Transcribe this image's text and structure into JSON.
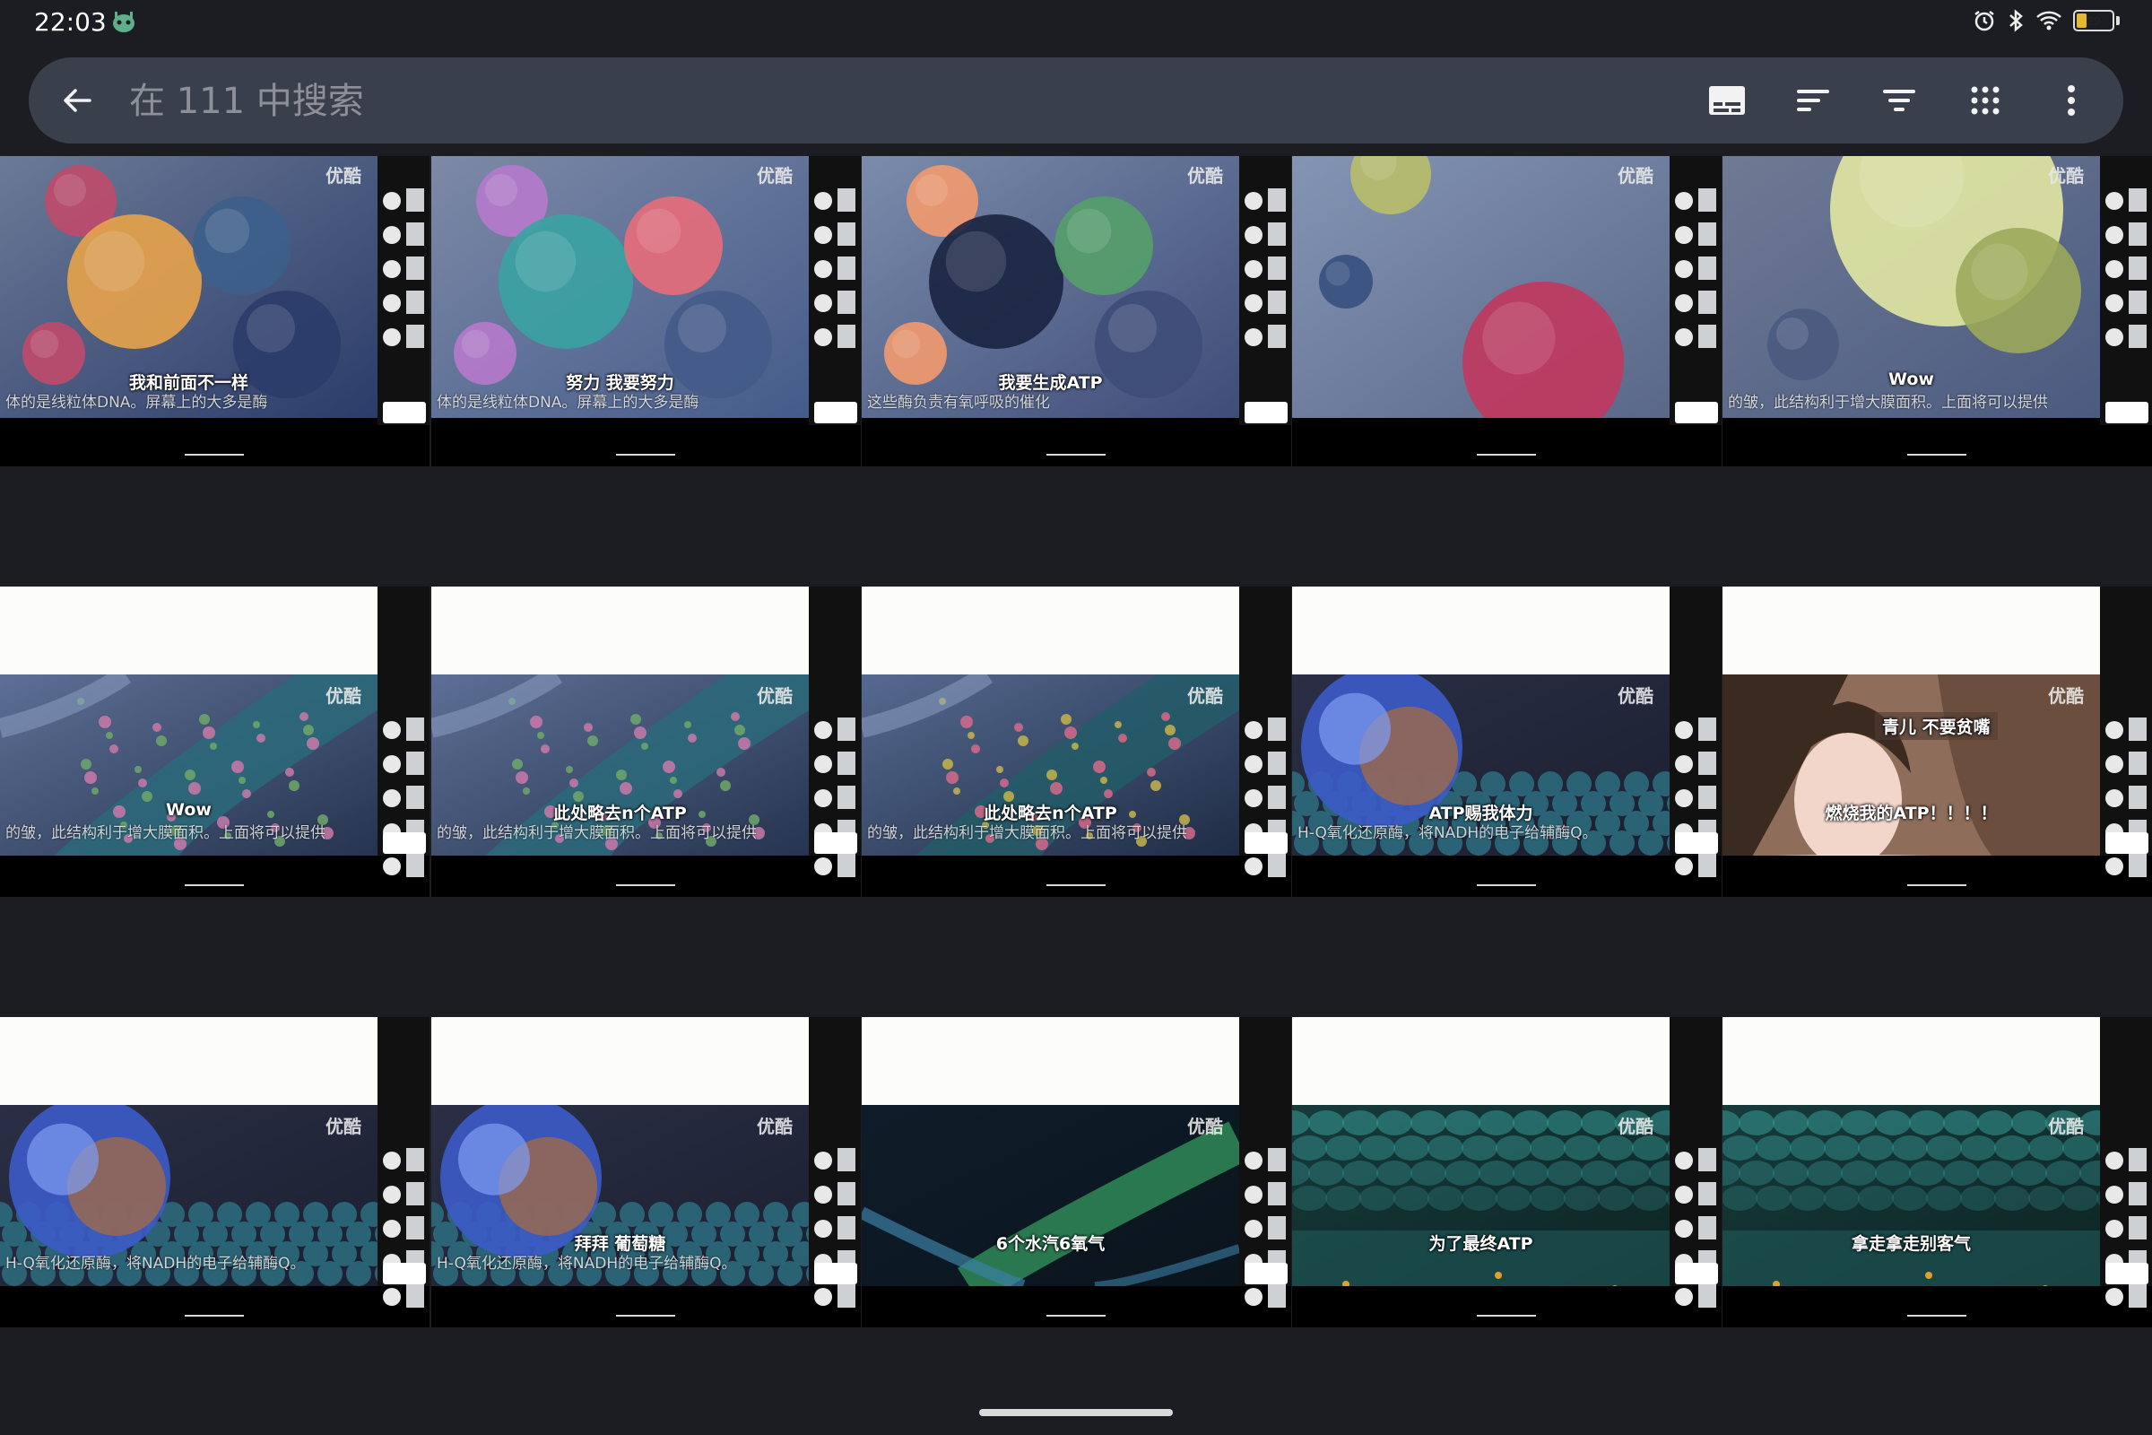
{
  "status": {
    "time": "22:03",
    "battery": "29",
    "battery_level": 0.29
  },
  "search": {
    "placeholder": "在 111 中搜索",
    "value": ""
  },
  "toolbar": [
    "subtitles-icon",
    "sort-icon",
    "filter-icon",
    "grid-view-icon",
    "more-vert-icon"
  ],
  "watermark": "优酷",
  "thumbnails": [
    {
      "caption": "我和前面不一样",
      "subtitle": "体的是线粒体DNA。屏幕上的大多是酶",
      "theme": "enzymes",
      "palette": [
        "#6b7a96",
        "#c04a6a",
        "#e8a34a",
        "#3d5f8c",
        "#2b3c6a"
      ]
    },
    {
      "caption": "努力 我要努力",
      "subtitle": "体的是线粒体DNA。屏幕上的大多是酶",
      "theme": "enzymes",
      "palette": [
        "#7d8aa6",
        "#b67acc",
        "#3aa3a3",
        "#e86d7a",
        "#445b8a"
      ]
    },
    {
      "caption": "我要生成ATP",
      "subtitle": "这些酶负责有氧呼吸的催化",
      "theme": "enzymes",
      "palette": [
        "#7b8cab",
        "#f29a6d",
        "#1a2340",
        "#55a06a",
        "#3e4c78"
      ]
    },
    {
      "caption": "",
      "subtitle": "",
      "theme": "protein",
      "palette": [
        "#8495b4",
        "#c2375e",
        "#b9be6a",
        "#36507e",
        "#5a6788"
      ]
    },
    {
      "caption": "Wow",
      "subtitle": "的皱，此结构利于增大膜面积。上面将可以提供",
      "theme": "protein-yellow",
      "palette": [
        "#6f7a94",
        "#e2e8a2",
        "#2e4a78",
        "#8ea05a",
        "#4b5a80"
      ]
    },
    {
      "caption": "Wow",
      "subtitle": "的皱，此结构利于增大膜面积。上面将可以提供",
      "theme": "membrane",
      "palette": [
        "#5d6f95",
        "#2c6a7a",
        "#c979a8",
        "#6fa86a",
        "#25344f"
      ]
    },
    {
      "caption": "此处略去n个ATP",
      "subtitle": "的皱，此结构利于增大膜面积。上面将可以提供",
      "theme": "membrane",
      "palette": [
        "#5d6f95",
        "#2c6a7a",
        "#c979a8",
        "#6fa86a",
        "#25344f"
      ]
    },
    {
      "caption": "此处略去n个ATP",
      "subtitle": "的皱，此结构利于增大膜面积。上面将可以提供",
      "theme": "membrane-close",
      "palette": [
        "#556a90",
        "#235c68",
        "#d66a8a",
        "#c5b44a",
        "#1f2c45"
      ]
    },
    {
      "caption": "ATP赐我体力",
      "subtitle": "H-Q氧化还原酶，将NADH的电子给辅酶Q。",
      "theme": "complex",
      "palette": [
        "#2a2f45",
        "#3c5bc8",
        "#a06a4a",
        "#2d6e80",
        "#1a1f30"
      ]
    },
    {
      "caption": "燃烧我的ATP！！！！",
      "subtitle": "",
      "theme": "drama",
      "palette": [
        "#8e6d5a",
        "#f1d6c9",
        "#3a2a20",
        "#c79a86",
        "#6b4e3e"
      ],
      "overlay": "青儿 不要贫嘴"
    },
    {
      "caption": "",
      "subtitle": "H-Q氧化还原酶，将NADH的电子给辅酶Q。",
      "theme": "complex",
      "palette": [
        "#2a2f45",
        "#3c5bc8",
        "#a06a4a",
        "#2d6e80",
        "#1a1f30"
      ]
    },
    {
      "caption": "拜拜  葡萄糖",
      "subtitle": "H-Q氧化还原酶，将NADH的电子给辅酶Q。",
      "theme": "complex",
      "palette": [
        "#2a2f45",
        "#3c5bc8",
        "#a06a4a",
        "#2d6e80",
        "#1a1f30"
      ]
    },
    {
      "caption": "6个水汽6氧气",
      "subtitle": "",
      "theme": "fibers",
      "palette": [
        "#0f1d2a",
        "#2f8a58",
        "#3b7fa4",
        "#1a3a4a",
        "#0a141c"
      ]
    },
    {
      "caption": "为了最终ATP",
      "subtitle": "",
      "theme": "membrane-lights",
      "palette": [
        "#163a3a",
        "#3aa4a0",
        "#e0a030",
        "#1f5a5a",
        "#0e2424"
      ]
    },
    {
      "caption": "拿走拿走别客气",
      "subtitle": "",
      "theme": "membrane-lights",
      "palette": [
        "#163a3a",
        "#3aa4a0",
        "#e0a030",
        "#1f5a5a",
        "#0e2424"
      ]
    }
  ]
}
